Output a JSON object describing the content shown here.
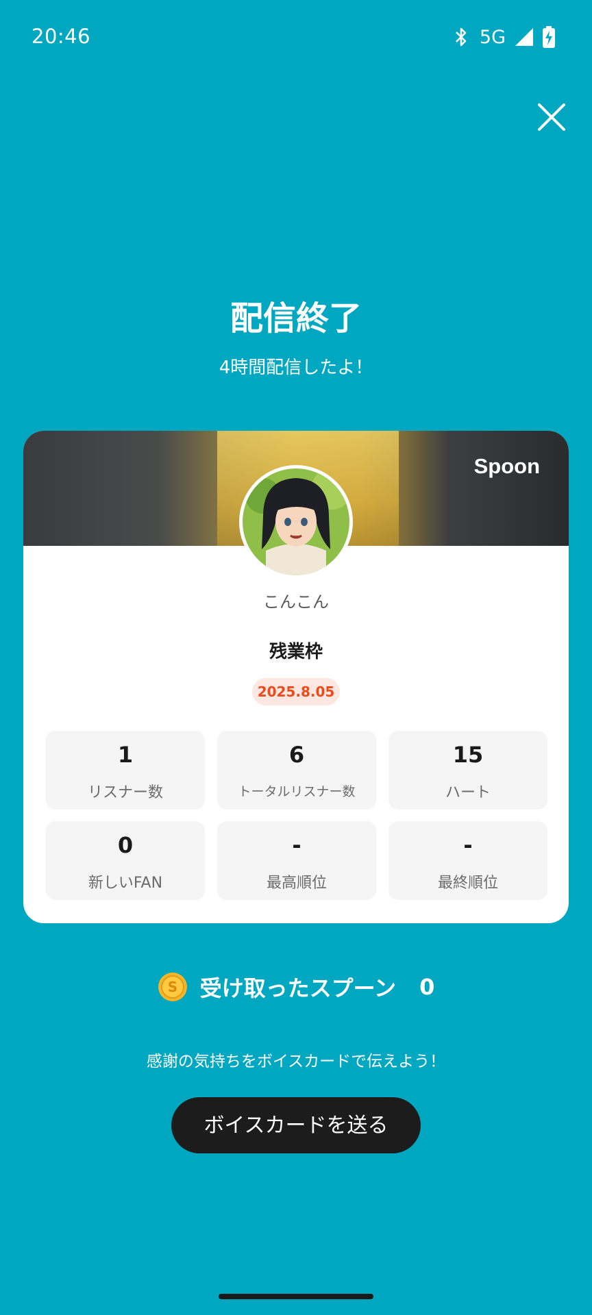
{
  "status_bar": {
    "time": "20:46",
    "network": "5G"
  },
  "header": {
    "title": "配信終了",
    "subtitle": "4時間配信したよ！"
  },
  "card": {
    "brand": "Spoon",
    "username": "こんこん",
    "broadcast_title": "残業枠",
    "date": "2025.8.05",
    "stats": [
      {
        "value": "1",
        "label": "リスナー数"
      },
      {
        "value": "6",
        "label": "トータルリスナー数"
      },
      {
        "value": "15",
        "label": "ハート"
      },
      {
        "value": "0",
        "label": "新しいFAN"
      },
      {
        "value": "-",
        "label": "最高順位"
      },
      {
        "value": "-",
        "label": "最終順位"
      }
    ]
  },
  "spoons": {
    "label": "受け取ったスプーン",
    "count": "0"
  },
  "footer": {
    "message": "感謝の気持ちをボイスカードで伝えよう！",
    "button_label": "ボイスカードを送る"
  },
  "colors": {
    "background": "#00a7c0",
    "button": "#1c1c1c",
    "date_badge_text": "#ea4b1a",
    "coin": "#f3b52a"
  }
}
